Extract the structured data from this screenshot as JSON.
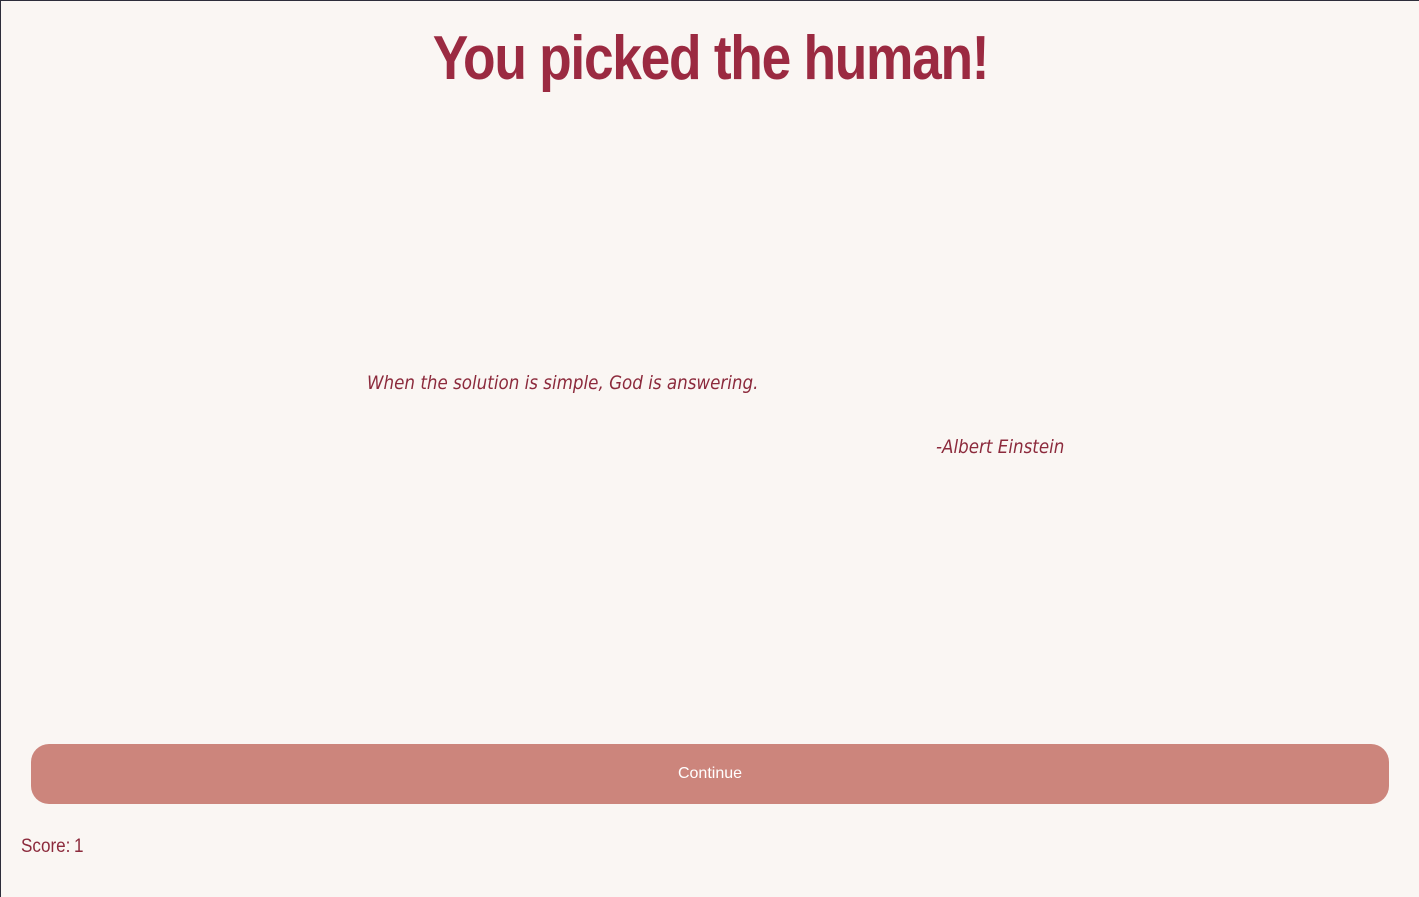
{
  "result": {
    "title": "You picked the human!"
  },
  "quote": {
    "text": "When the solution is simple, God is answering.",
    "author": "-Albert Einstein"
  },
  "actions": {
    "continue_label": "Continue"
  },
  "score": {
    "label": "Score:",
    "value": "1"
  },
  "colors": {
    "background": "#faf6f3",
    "title": "#9b2a41",
    "quote": "#8c2a3c",
    "button": "#cc857c",
    "button_text": "#ffffff"
  }
}
